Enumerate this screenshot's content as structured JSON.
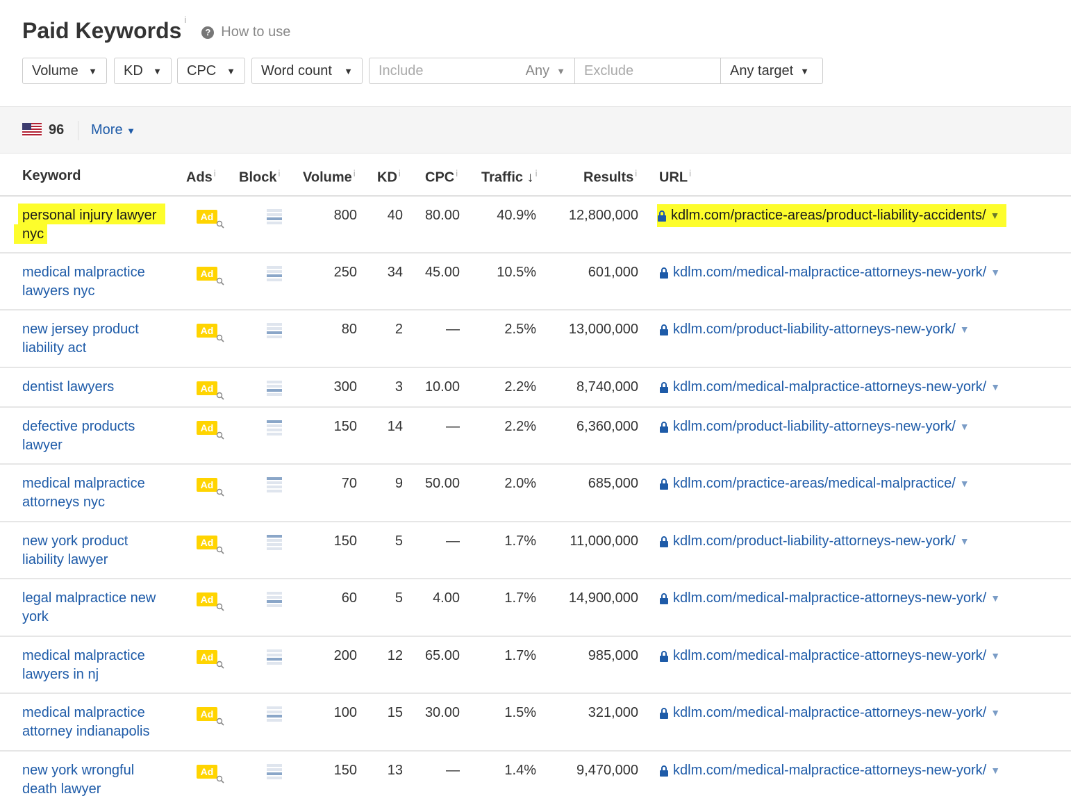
{
  "header": {
    "title": "Paid Keywords",
    "info": "i",
    "how_to_use": "How to use",
    "help_icon": "?"
  },
  "filters": {
    "volume": "Volume",
    "kd": "KD",
    "cpc": "CPC",
    "word_count": "Word count",
    "include_placeholder": "Include",
    "any": "Any",
    "exclude_placeholder": "Exclude",
    "any_target": "Any target"
  },
  "toolbar": {
    "country": "US",
    "count": "96",
    "more": "More"
  },
  "table": {
    "headers": {
      "keyword": "Keyword",
      "ads": "Ads",
      "block": "Block",
      "volume": "Volume",
      "kd": "KD",
      "cpc": "CPC",
      "traffic": "Traffic",
      "results": "Results",
      "url": "URL"
    },
    "ad_label": "Ad",
    "rows": [
      {
        "keyword": "personal injury lawyer nyc",
        "volume": "800",
        "kd": "40",
        "cpc": "80.00",
        "traffic": "40.9%",
        "results": "12,800,000",
        "url": "kdlm.com/practice-areas/product-liability-accidents/"
      },
      {
        "keyword": "medical malpractice lawyers nyc",
        "volume": "250",
        "kd": "34",
        "cpc": "45.00",
        "traffic": "10.5%",
        "results": "601,000",
        "url": "kdlm.com/medical-malpractice-attorneys-new-york/"
      },
      {
        "keyword": "new jersey product liability act",
        "volume": "80",
        "kd": "2",
        "cpc": "—",
        "traffic": "2.5%",
        "results": "13,000,000",
        "url": "kdlm.com/product-liability-attorneys-new-york/"
      },
      {
        "keyword": "dentist lawyers",
        "volume": "300",
        "kd": "3",
        "cpc": "10.00",
        "traffic": "2.2%",
        "results": "8,740,000",
        "url": "kdlm.com/medical-malpractice-attorneys-new-york/"
      },
      {
        "keyword": "defective products lawyer",
        "volume": "150",
        "kd": "14",
        "cpc": "—",
        "traffic": "2.2%",
        "results": "6,360,000",
        "url": "kdlm.com/product-liability-attorneys-new-york/"
      },
      {
        "keyword": "medical malpractice attorneys nyc",
        "volume": "70",
        "kd": "9",
        "cpc": "50.00",
        "traffic": "2.0%",
        "results": "685,000",
        "url": "kdlm.com/practice-areas/medical-malpractice/"
      },
      {
        "keyword": "new york product liability lawyer",
        "volume": "150",
        "kd": "5",
        "cpc": "—",
        "traffic": "1.7%",
        "results": "11,000,000",
        "url": "kdlm.com/product-liability-attorneys-new-york/"
      },
      {
        "keyword": "legal malpractice new york",
        "volume": "60",
        "kd": "5",
        "cpc": "4.00",
        "traffic": "1.7%",
        "results": "14,900,000",
        "url": "kdlm.com/medical-malpractice-attorneys-new-york/"
      },
      {
        "keyword": "medical malpractice lawyers in nj",
        "volume": "200",
        "kd": "12",
        "cpc": "65.00",
        "traffic": "1.7%",
        "results": "985,000",
        "url": "kdlm.com/medical-malpractice-attorneys-new-york/"
      },
      {
        "keyword": "medical malpractice attorney indianapolis",
        "volume": "100",
        "kd": "15",
        "cpc": "30.00",
        "traffic": "1.5%",
        "results": "321,000",
        "url": "kdlm.com/medical-malpractice-attorneys-new-york/"
      },
      {
        "keyword": "new york wrongful death lawyer",
        "volume": "150",
        "kd": "13",
        "cpc": "—",
        "traffic": "1.4%",
        "results": "9,470,000",
        "url": "kdlm.com/medical-malpractice-attorneys-new-york/"
      }
    ]
  },
  "colors": {
    "link": "#1e5ba8",
    "highlight": "#fdfd2c",
    "ad_badge": "#ffd400",
    "lock": "#1e5ba8"
  }
}
